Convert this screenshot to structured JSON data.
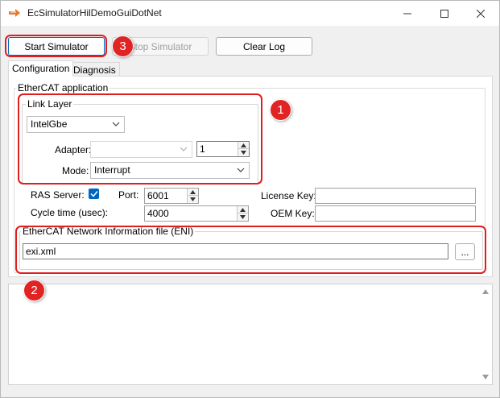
{
  "window": {
    "title": "EcSimulatorHilDemoGuiDotNet",
    "minimize_icon": "minimize-icon",
    "maximize_icon": "maximize-icon",
    "close_icon": "close-icon"
  },
  "toolbar": {
    "start_label": "Start Simulator",
    "stop_label": "Stop Simulator",
    "clear_label": "Clear Log"
  },
  "tabs": [
    {
      "label": "Configuration",
      "active": true
    },
    {
      "label": "Diagnosis",
      "active": false
    }
  ],
  "config": {
    "ethercat_app_label": "EtherCAT application",
    "link_layer": {
      "group_label": "Link Layer",
      "driver_value": "IntelGbe",
      "adapter_label": "Adapter:",
      "adapter_value": "",
      "instance_value": "1",
      "mode_label": "Mode:",
      "mode_value": "Interrupt"
    },
    "ras_server_label": "RAS Server:",
    "ras_server_checked": true,
    "port_label": "Port:",
    "port_value": "6001",
    "cycle_time_label": "Cycle time (usec):",
    "cycle_time_value": "4000",
    "license_key_label": "License Key:",
    "license_key_value": "",
    "oem_key_label": "OEM Key:",
    "oem_key_value": "",
    "eni": {
      "group_label": "EtherCAT Network Information file (ENI)",
      "file_value": "exi.xml",
      "browse_label": "..."
    }
  },
  "log": {
    "text": ""
  },
  "annotations": {
    "marker_1": "1",
    "marker_2": "2",
    "marker_3": "3",
    "highlight_color": "#e11d1d"
  },
  "colors": {
    "accent": "#0067c0",
    "window_bg": "#f0f0f0",
    "panel_bg": "#ffffff"
  }
}
